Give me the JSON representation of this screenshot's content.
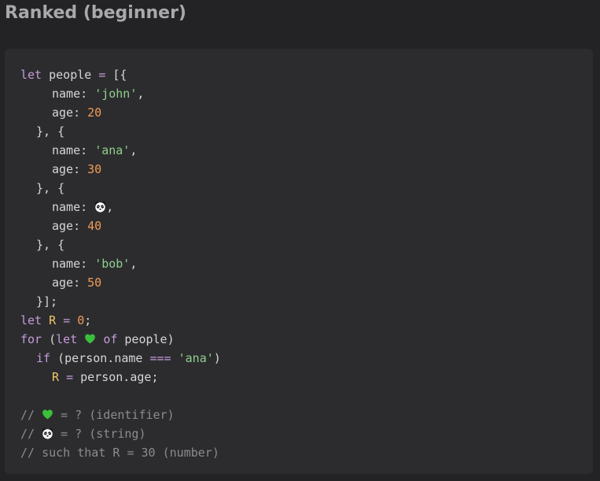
{
  "page": {
    "title": "Ranked (beginner)"
  },
  "code": {
    "kw_let": "let",
    "kw_for": "for",
    "kw_of": "of",
    "kw_if": "if",
    "var_people": "people",
    "var_R": "R",
    "prop_name": "name",
    "prop_age": "age",
    "str_john": "'john'",
    "str_ana": "'ana'",
    "str_bob": "'bob'",
    "num_20": "20",
    "num_30": "30",
    "num_40": "40",
    "num_50": "50",
    "num_0": "0",
    "expr_person_name": "person.name",
    "expr_person_age": "person.age",
    "op_strict_eq": "===",
    "comment_identifier": "= ? (identifier)",
    "comment_string": "= ? (string)",
    "comment_result": "// such that R = 30 (number)",
    "comment_prefix": "//"
  },
  "icons": {
    "heart": "green-heart-icon",
    "panda": "panda-face-icon"
  },
  "colors": {
    "background": "#232325",
    "code_background": "#2c2c2f",
    "keyword": "#c49bd8",
    "string": "#8fcf8a",
    "number": "#f09a55",
    "variable": "#f1c66a",
    "comment": "#8c8c90",
    "heart": "#3cbf3a"
  }
}
